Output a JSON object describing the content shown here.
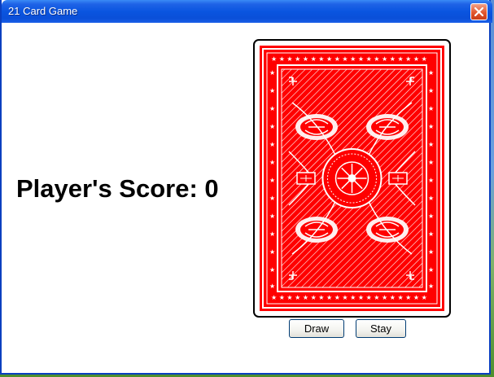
{
  "window": {
    "title": "21 Card Game",
    "close_icon": "close-icon"
  },
  "game": {
    "score_label": "Player's Score: 0",
    "card_image": "card-back-image",
    "card_color": "#ff0000"
  },
  "buttons": {
    "draw_label": "Draw",
    "stay_label": "Stay"
  }
}
